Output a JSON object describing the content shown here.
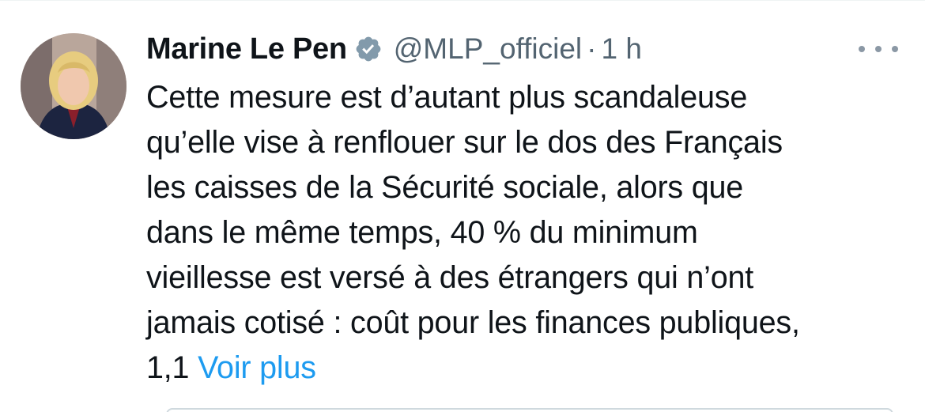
{
  "tweet": {
    "author_name": "Marine Le Pen",
    "handle": "@MLP_officiel",
    "separator": "·",
    "time": "1 h",
    "lines": [
      "Cette mesure est d’autant plus scandaleuse",
      "qu’elle vise à renflouer sur le dos des Français",
      "les caisses de la Sécurité sociale, alors que",
      "dans le même temps, 40 % du minimum",
      "vieillesse est versé à des étrangers qui n’ont",
      "jamais cotisé : coût pour les finances publiques,"
    ],
    "last_line_start": "1,1 ",
    "show_more": "Voir plus"
  },
  "icons": {
    "verified": "verified-badge-icon",
    "more": "more-horizontal-icon"
  },
  "colors": {
    "text": "#0f1419",
    "secondary": "#536471",
    "link": "#1d9bf0",
    "badge": "#829aab"
  }
}
